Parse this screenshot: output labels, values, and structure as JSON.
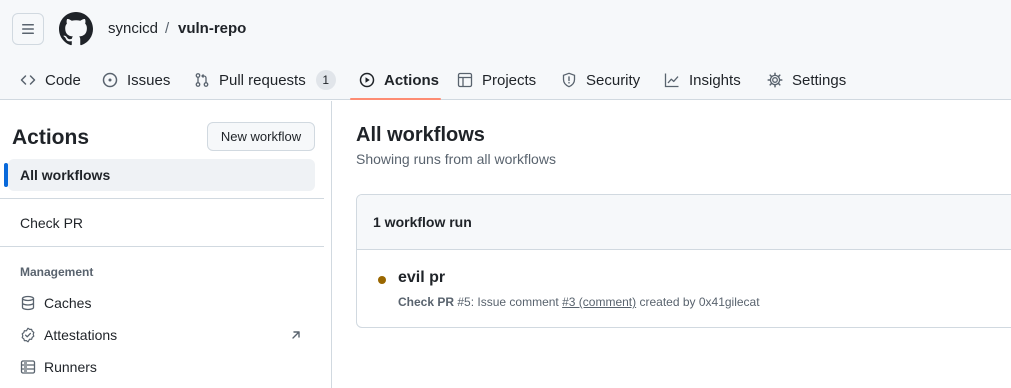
{
  "header": {
    "owner": "syncicd",
    "separator": "/",
    "repo": "vuln-repo"
  },
  "nav": {
    "tabs": [
      {
        "label": "Code",
        "icon": "code-icon"
      },
      {
        "label": "Issues",
        "icon": "issue-opened-icon"
      },
      {
        "label": "Pull requests",
        "icon": "git-pull-request-icon",
        "count": "1"
      },
      {
        "label": "Actions",
        "icon": "play-icon",
        "selected": true
      },
      {
        "label": "Projects",
        "icon": "table-icon"
      },
      {
        "label": "Security",
        "icon": "shield-icon"
      },
      {
        "label": "Insights",
        "icon": "graph-icon"
      },
      {
        "label": "Settings",
        "icon": "gear-icon"
      }
    ],
    "accent_color": "#fd8c73"
  },
  "sidebar": {
    "title": "Actions",
    "new_workflow_label": "New workflow",
    "workflows": [
      {
        "label": "All workflows",
        "active": true
      },
      {
        "label": "Check PR"
      }
    ],
    "management_heading": "Management",
    "management_items": [
      {
        "label": "Caches",
        "icon": "database-icon"
      },
      {
        "label": "Attestations",
        "icon": "verified-icon",
        "external": true
      },
      {
        "label": "Runners",
        "icon": "server-icon"
      }
    ]
  },
  "main": {
    "title": "All workflows",
    "subtitle": "Showing runs from all workflows",
    "runs_count_label": "1 workflow run",
    "runs": [
      {
        "title": "evil pr",
        "status_color": "#9a6700",
        "workflow": "Check PR",
        "run_number": "#5",
        "event_text": ": Issue comment ",
        "link_text": "#3 (comment)",
        "created_by": " created by 0x41gilecat"
      }
    ]
  }
}
